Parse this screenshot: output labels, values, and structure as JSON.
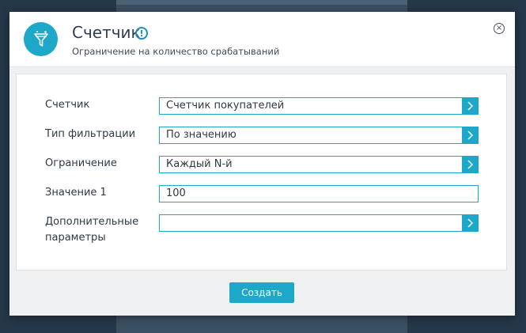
{
  "dialog": {
    "title": "Счетчик",
    "subtitle": "Ограничение на количество срабатываний",
    "info_icon": "info-icon",
    "close_icon": "close-icon",
    "header_icon": "funnel-icon"
  },
  "form": {
    "fields": [
      {
        "label": "Счетчик",
        "value": "Счетчик покупателей",
        "has_arrow": true
      },
      {
        "label": "Тип фильтрации",
        "value": "По значению",
        "has_arrow": true
      },
      {
        "label": "Ограничение",
        "value": "Каждый N-й",
        "has_arrow": true
      },
      {
        "label": "Значение 1",
        "value": "100",
        "has_arrow": false
      },
      {
        "label_line1": "Дополнительные",
        "label_line2": "параметры",
        "value": "",
        "has_arrow": true
      }
    ]
  },
  "footer": {
    "create_label": "Создать"
  },
  "colors": {
    "accent": "#1da8c9",
    "background": "#25384a"
  }
}
